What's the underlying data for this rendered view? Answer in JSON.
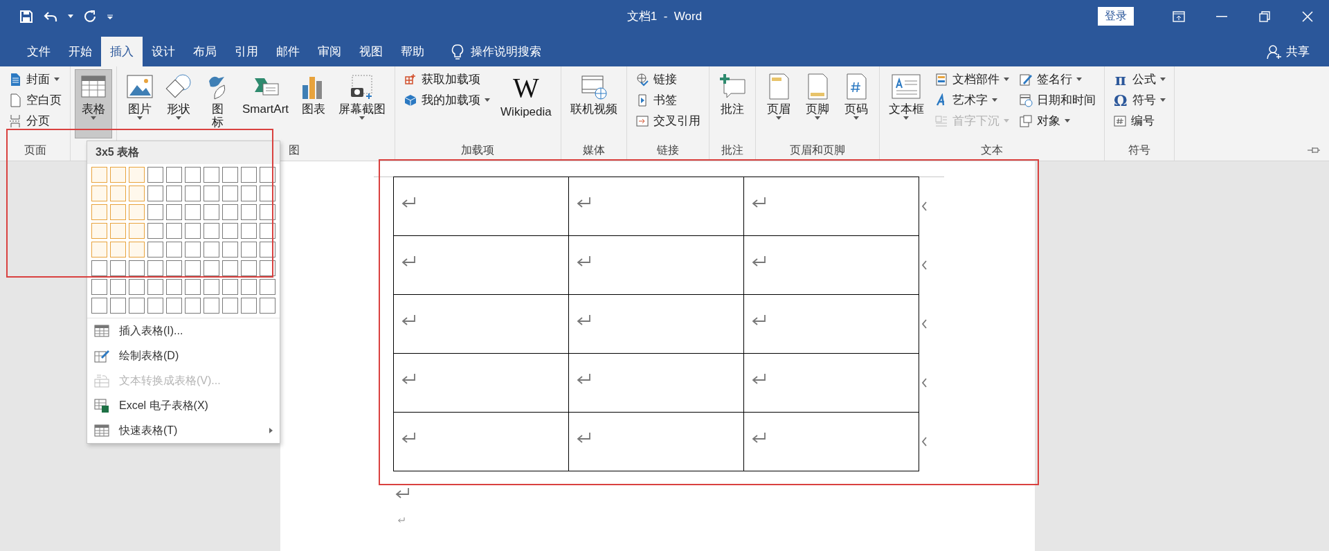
{
  "window": {
    "title": "文档1  -  Word",
    "sign_in": "登录"
  },
  "tabs": [
    {
      "label": "文件",
      "selected": false
    },
    {
      "label": "开始",
      "selected": false
    },
    {
      "label": "插入",
      "selected": true
    },
    {
      "label": "设计",
      "selected": false
    },
    {
      "label": "布局",
      "selected": false
    },
    {
      "label": "引用",
      "selected": false
    },
    {
      "label": "邮件",
      "selected": false
    },
    {
      "label": "审阅",
      "selected": false
    },
    {
      "label": "视图",
      "selected": false
    },
    {
      "label": "帮助",
      "selected": false
    }
  ],
  "search": {
    "placeholder": "操作说明搜索"
  },
  "share": "共享",
  "ribbon": {
    "groups": [
      {
        "label": "页面",
        "items": [
          {
            "kind": "small",
            "label": "封面",
            "caret": true,
            "pressed": false,
            "disabled": false
          },
          {
            "kind": "small",
            "label": "空白页",
            "caret": false,
            "pressed": false,
            "disabled": false
          },
          {
            "kind": "small",
            "label": "分页",
            "caret": false,
            "pressed": false,
            "disabled": false
          }
        ]
      },
      {
        "items": [
          {
            "kind": "large",
            "label": "表格",
            "caret": true,
            "pressed": true,
            "disabled": false
          }
        ]
      },
      {
        "label": "图",
        "items": [
          {
            "kind": "large",
            "label": "图片",
            "caret": true,
            "pressed": false,
            "disabled": false
          },
          {
            "kind": "large",
            "label": "形状",
            "caret": true,
            "pressed": false,
            "disabled": false
          },
          {
            "kind": "large",
            "label": "图标",
            "caret": false,
            "pressed": false,
            "disabled": false
          },
          {
            "kind": "large",
            "label": "SmartArt",
            "caret": false,
            "pressed": false,
            "disabled": false
          },
          {
            "kind": "large",
            "label": "图表",
            "caret": false,
            "pressed": false,
            "disabled": false
          },
          {
            "kind": "large",
            "label": "屏幕截图",
            "caret": true,
            "pressed": false,
            "disabled": false
          }
        ]
      },
      {
        "label": "加载项",
        "items": [
          {
            "kind": "small",
            "label": "获取加载项",
            "caret": false,
            "pressed": false,
            "disabled": false
          },
          {
            "kind": "small",
            "label": "我的加载项",
            "caret": true,
            "pressed": false,
            "disabled": false
          },
          {
            "kind": "large",
            "label": "Wikipedia",
            "glyph": "W",
            "caret": false,
            "pressed": false,
            "disabled": false
          }
        ]
      },
      {
        "label": "媒体",
        "items": [
          {
            "kind": "large",
            "label": "联机视频",
            "caret": false,
            "pressed": false,
            "disabled": false
          }
        ]
      },
      {
        "label": "链接",
        "items": [
          {
            "kind": "small",
            "label": "链接",
            "caret": false,
            "pressed": false,
            "disabled": false
          },
          {
            "kind": "small",
            "label": "书签",
            "caret": false,
            "pressed": false,
            "disabled": false
          },
          {
            "kind": "small",
            "label": "交叉引用",
            "caret": false,
            "pressed": false,
            "disabled": false
          }
        ]
      },
      {
        "label": "批注",
        "items": [
          {
            "kind": "large",
            "label": "批注",
            "caret": false,
            "pressed": false,
            "disabled": false
          }
        ]
      },
      {
        "label": "页眉和页脚",
        "items": [
          {
            "kind": "large",
            "label": "页眉",
            "caret": true,
            "pressed": false,
            "disabled": false
          },
          {
            "kind": "large",
            "label": "页脚",
            "caret": true,
            "pressed": false,
            "disabled": false
          },
          {
            "kind": "large",
            "label": "页码",
            "caret": true,
            "pressed": false,
            "disabled": false
          }
        ]
      },
      {
        "label": "文本",
        "items": [
          {
            "kind": "large",
            "label": "文本框",
            "caret": true,
            "pressed": false,
            "disabled": false
          },
          {
            "kind": "small",
            "label": "文档部件",
            "caret": true,
            "pressed": false,
            "disabled": false
          },
          {
            "kind": "small",
            "label": "艺术字",
            "caret": true,
            "pressed": false,
            "disabled": false
          },
          {
            "kind": "small",
            "label": "首字下沉",
            "caret": true,
            "pressed": false,
            "disabled": true
          },
          {
            "kind": "small",
            "label": "签名行",
            "caret": true,
            "pressed": false,
            "disabled": false
          },
          {
            "kind": "small",
            "label": "日期和时间",
            "caret": false,
            "pressed": false,
            "disabled": false
          },
          {
            "kind": "small",
            "label": "对象",
            "caret": true,
            "pressed": false,
            "disabled": false
          }
        ]
      },
      {
        "label": "符号",
        "items": [
          {
            "kind": "small",
            "label": "公式",
            "glyph": "π",
            "caret": true,
            "pressed": false,
            "disabled": false
          },
          {
            "kind": "small",
            "label": "符号",
            "glyph": "Ω",
            "caret": true,
            "pressed": false,
            "disabled": false
          },
          {
            "kind": "small",
            "label": "编号",
            "caret": false,
            "pressed": false,
            "disabled": false
          }
        ]
      }
    ]
  },
  "table_menu": {
    "title": "3x5 表格",
    "grid": [
      {
        "cells": [
          {
            "selected": true
          },
          {
            "selected": true
          },
          {
            "selected": true
          },
          {
            "selected": false
          },
          {
            "selected": false
          },
          {
            "selected": false
          },
          {
            "selected": false
          },
          {
            "selected": false
          },
          {
            "selected": false
          },
          {
            "selected": false
          }
        ]
      },
      {
        "cells": [
          {
            "selected": true
          },
          {
            "selected": true
          },
          {
            "selected": true
          },
          {
            "selected": false
          },
          {
            "selected": false
          },
          {
            "selected": false
          },
          {
            "selected": false
          },
          {
            "selected": false
          },
          {
            "selected": false
          },
          {
            "selected": false
          }
        ]
      },
      {
        "cells": [
          {
            "selected": true
          },
          {
            "selected": true
          },
          {
            "selected": true
          },
          {
            "selected": false
          },
          {
            "selected": false
          },
          {
            "selected": false
          },
          {
            "selected": false
          },
          {
            "selected": false
          },
          {
            "selected": false
          },
          {
            "selected": false
          }
        ]
      },
      {
        "cells": [
          {
            "selected": true
          },
          {
            "selected": true
          },
          {
            "selected": true
          },
          {
            "selected": false
          },
          {
            "selected": false
          },
          {
            "selected": false
          },
          {
            "selected": false
          },
          {
            "selected": false
          },
          {
            "selected": false
          },
          {
            "selected": false
          }
        ]
      },
      {
        "cells": [
          {
            "selected": true
          },
          {
            "selected": true
          },
          {
            "selected": true
          },
          {
            "selected": false
          },
          {
            "selected": false
          },
          {
            "selected": false
          },
          {
            "selected": false
          },
          {
            "selected": false
          },
          {
            "selected": false
          },
          {
            "selected": false
          }
        ]
      },
      {
        "cells": [
          {
            "selected": false
          },
          {
            "selected": false
          },
          {
            "selected": false
          },
          {
            "selected": false
          },
          {
            "selected": false
          },
          {
            "selected": false
          },
          {
            "selected": false
          },
          {
            "selected": false
          },
          {
            "selected": false
          },
          {
            "selected": false
          }
        ]
      },
      {
        "cells": [
          {
            "selected": false
          },
          {
            "selected": false
          },
          {
            "selected": false
          },
          {
            "selected": false
          },
          {
            "selected": false
          },
          {
            "selected": false
          },
          {
            "selected": false
          },
          {
            "selected": false
          },
          {
            "selected": false
          },
          {
            "selected": false
          }
        ]
      },
      {
        "cells": [
          {
            "selected": false
          },
          {
            "selected": false
          },
          {
            "selected": false
          },
          {
            "selected": false
          },
          {
            "selected": false
          },
          {
            "selected": false
          },
          {
            "selected": false
          },
          {
            "selected": false
          },
          {
            "selected": false
          },
          {
            "selected": false
          }
        ]
      }
    ],
    "items": [
      {
        "label": "插入表格(I)...",
        "disabled": false,
        "submenu": false
      },
      {
        "label": "绘制表格(D)",
        "disabled": false,
        "submenu": false
      },
      {
        "label": "文本转换成表格(V)...",
        "disabled": true,
        "submenu": false
      },
      {
        "label": "Excel 电子表格(X)",
        "disabled": false,
        "submenu": false
      },
      {
        "label": "快速表格(T)",
        "disabled": false,
        "submenu": true
      }
    ]
  },
  "document": {
    "table": {
      "rows": [
        {
          "end_mark": true,
          "cells": [
            {
              "paragraph_mark": true
            },
            {
              "paragraph_mark": true
            },
            {
              "paragraph_mark": true
            }
          ]
        },
        {
          "end_mark": true,
          "cells": [
            {
              "paragraph_mark": true
            },
            {
              "paragraph_mark": true
            },
            {
              "paragraph_mark": true
            }
          ]
        },
        {
          "end_mark": true,
          "cells": [
            {
              "paragraph_mark": true
            },
            {
              "paragraph_mark": true
            },
            {
              "paragraph_mark": true
            }
          ]
        },
        {
          "end_mark": true,
          "cells": [
            {
              "paragraph_mark": true
            },
            {
              "paragraph_mark": true
            },
            {
              "paragraph_mark": true
            }
          ]
        },
        {
          "end_mark": true,
          "cells": [
            {
              "paragraph_mark": true
            },
            {
              "paragraph_mark": true
            },
            {
              "paragraph_mark": true
            }
          ]
        }
      ]
    },
    "paragraphs": [
      {
        "paragraph_mark": true
      },
      {
        "paragraph_mark": true
      }
    ]
  }
}
